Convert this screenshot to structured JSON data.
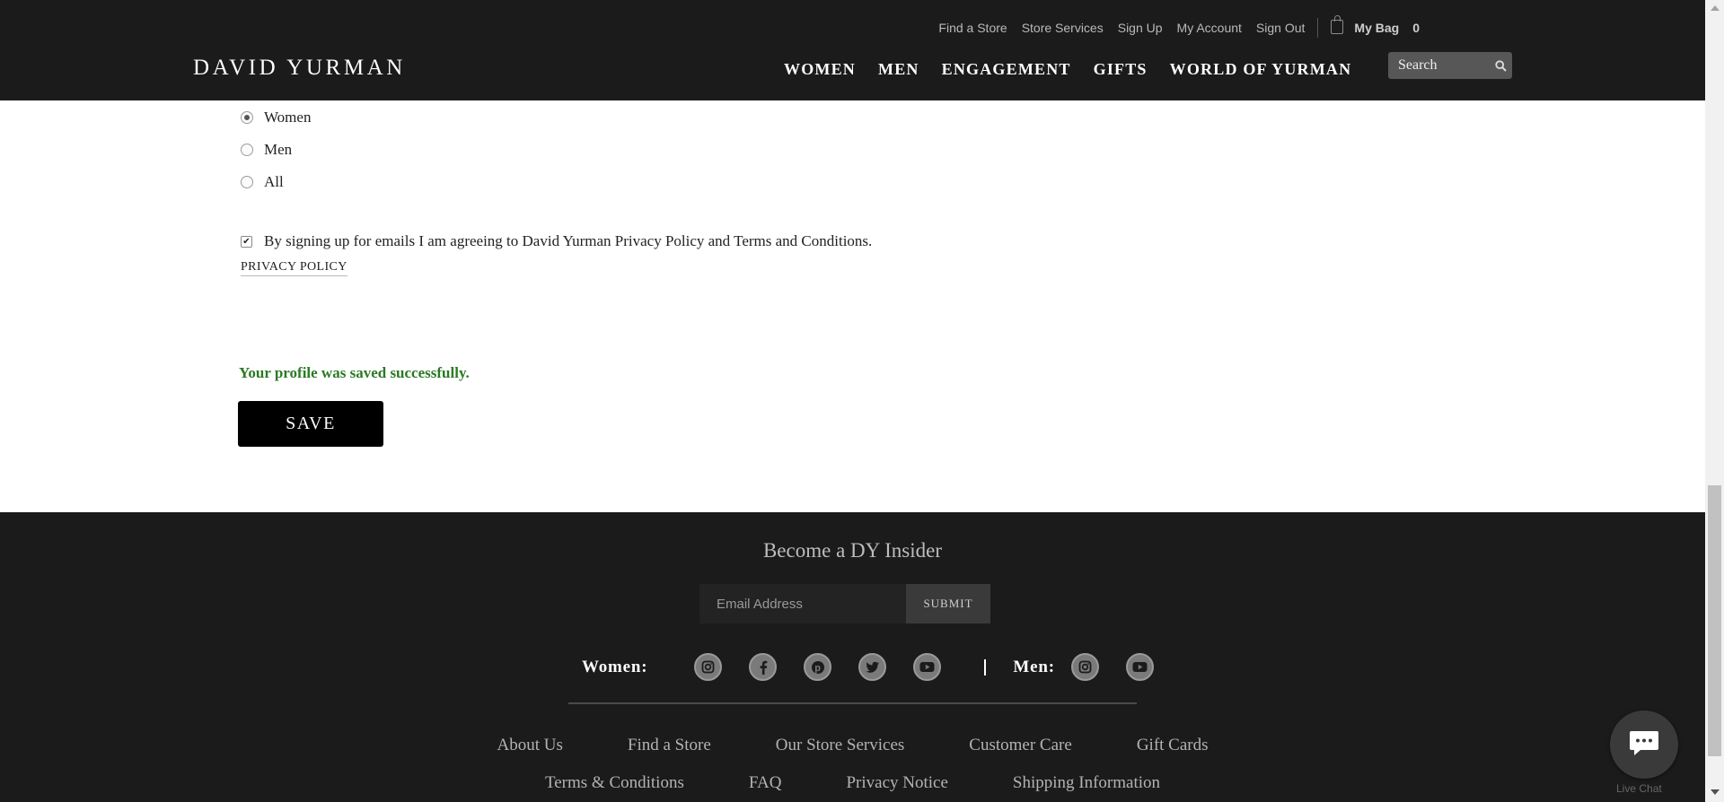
{
  "header": {
    "utility_links": [
      "Find a Store",
      "Store Services",
      "Sign Up",
      "My Account",
      "Sign Out"
    ],
    "bag_label": "My Bag",
    "bag_count": "0",
    "logo": "DAVID YURMAN",
    "nav": [
      "WOMEN",
      "MEN",
      "ENGAGEMENT",
      "GIFTS",
      "WORLD OF YURMAN"
    ],
    "search_placeholder": "Search"
  },
  "form": {
    "preference_options": [
      {
        "label": "Women",
        "selected": true
      },
      {
        "label": "Men",
        "selected": false
      },
      {
        "label": "All",
        "selected": false
      }
    ],
    "consent_text": "By signing up for emails I am agreeing to David Yurman Privacy Policy and Terms and Conditions.",
    "consent_checked": true,
    "privacy_link": "PRIVACY POLICY",
    "success_message": "Your profile was saved successfully.",
    "save_label": "SAVE"
  },
  "footer": {
    "insider_title": "Become a DY Insider",
    "email_placeholder": "Email Address",
    "submit_label": "SUBMIT",
    "women_label": "Women:",
    "men_label": "Men:",
    "women_social": [
      "instagram-icon",
      "facebook-icon",
      "pinterest-icon",
      "twitter-icon",
      "youtube-icon"
    ],
    "men_social": [
      "instagram-icon",
      "youtube-icon"
    ],
    "links_row1": [
      "About Us",
      "Find a Store",
      "Our Store Services",
      "Customer Care",
      "Gift Cards"
    ],
    "links_row2": [
      "Terms & Conditions",
      "FAQ",
      "Privacy Notice",
      "Shipping Information"
    ]
  },
  "chat": {
    "label": "Live Chat"
  },
  "colors": {
    "header_bg": "#1b1b1b",
    "success_green": "#2a7a23",
    "save_button_bg": "#000000"
  }
}
